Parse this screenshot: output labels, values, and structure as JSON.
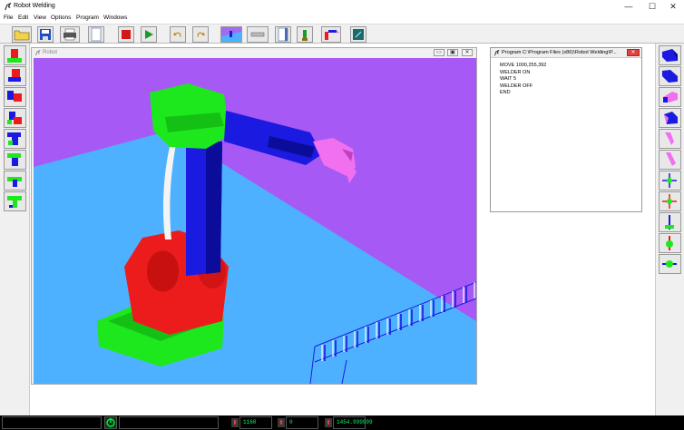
{
  "window": {
    "title": "Robot Welding",
    "minimize": "—",
    "maximize": "☐",
    "close": "✕"
  },
  "menu": [
    "File",
    "Edit",
    "View",
    "Options",
    "Program",
    "Windows"
  ],
  "toolbar": {
    "buttons": [
      "open-folder",
      "save",
      "print",
      "new-page",
      "stop",
      "play",
      "undo",
      "redo",
      "view-perspective",
      "view-side",
      "view-front",
      "robot-pose",
      "robot-weld",
      "program-editor"
    ]
  },
  "robot_window": {
    "title": "Robot",
    "min": "▭",
    "max": "▣",
    "close": "✕",
    "colors": {
      "sky": "#a659f4",
      "floor": "#4db1ff",
      "green": "#1de81d",
      "red": "#ec1c1c",
      "blue": "#1a1ae0",
      "pink": "#f070f0",
      "white": "#f0f0f0"
    }
  },
  "program_window": {
    "title": "Program C:\\Program Files (x86)\\Robot Welding\\P...",
    "lines": [
      "MOVE 1000,255,392",
      "WELDER ON",
      "WAIT 5",
      "WELDER OFF",
      "END"
    ]
  },
  "status": {
    "left_field": "",
    "field2": "",
    "value_x": "1160",
    "value_y": "0",
    "value_z": "1454.999999"
  }
}
